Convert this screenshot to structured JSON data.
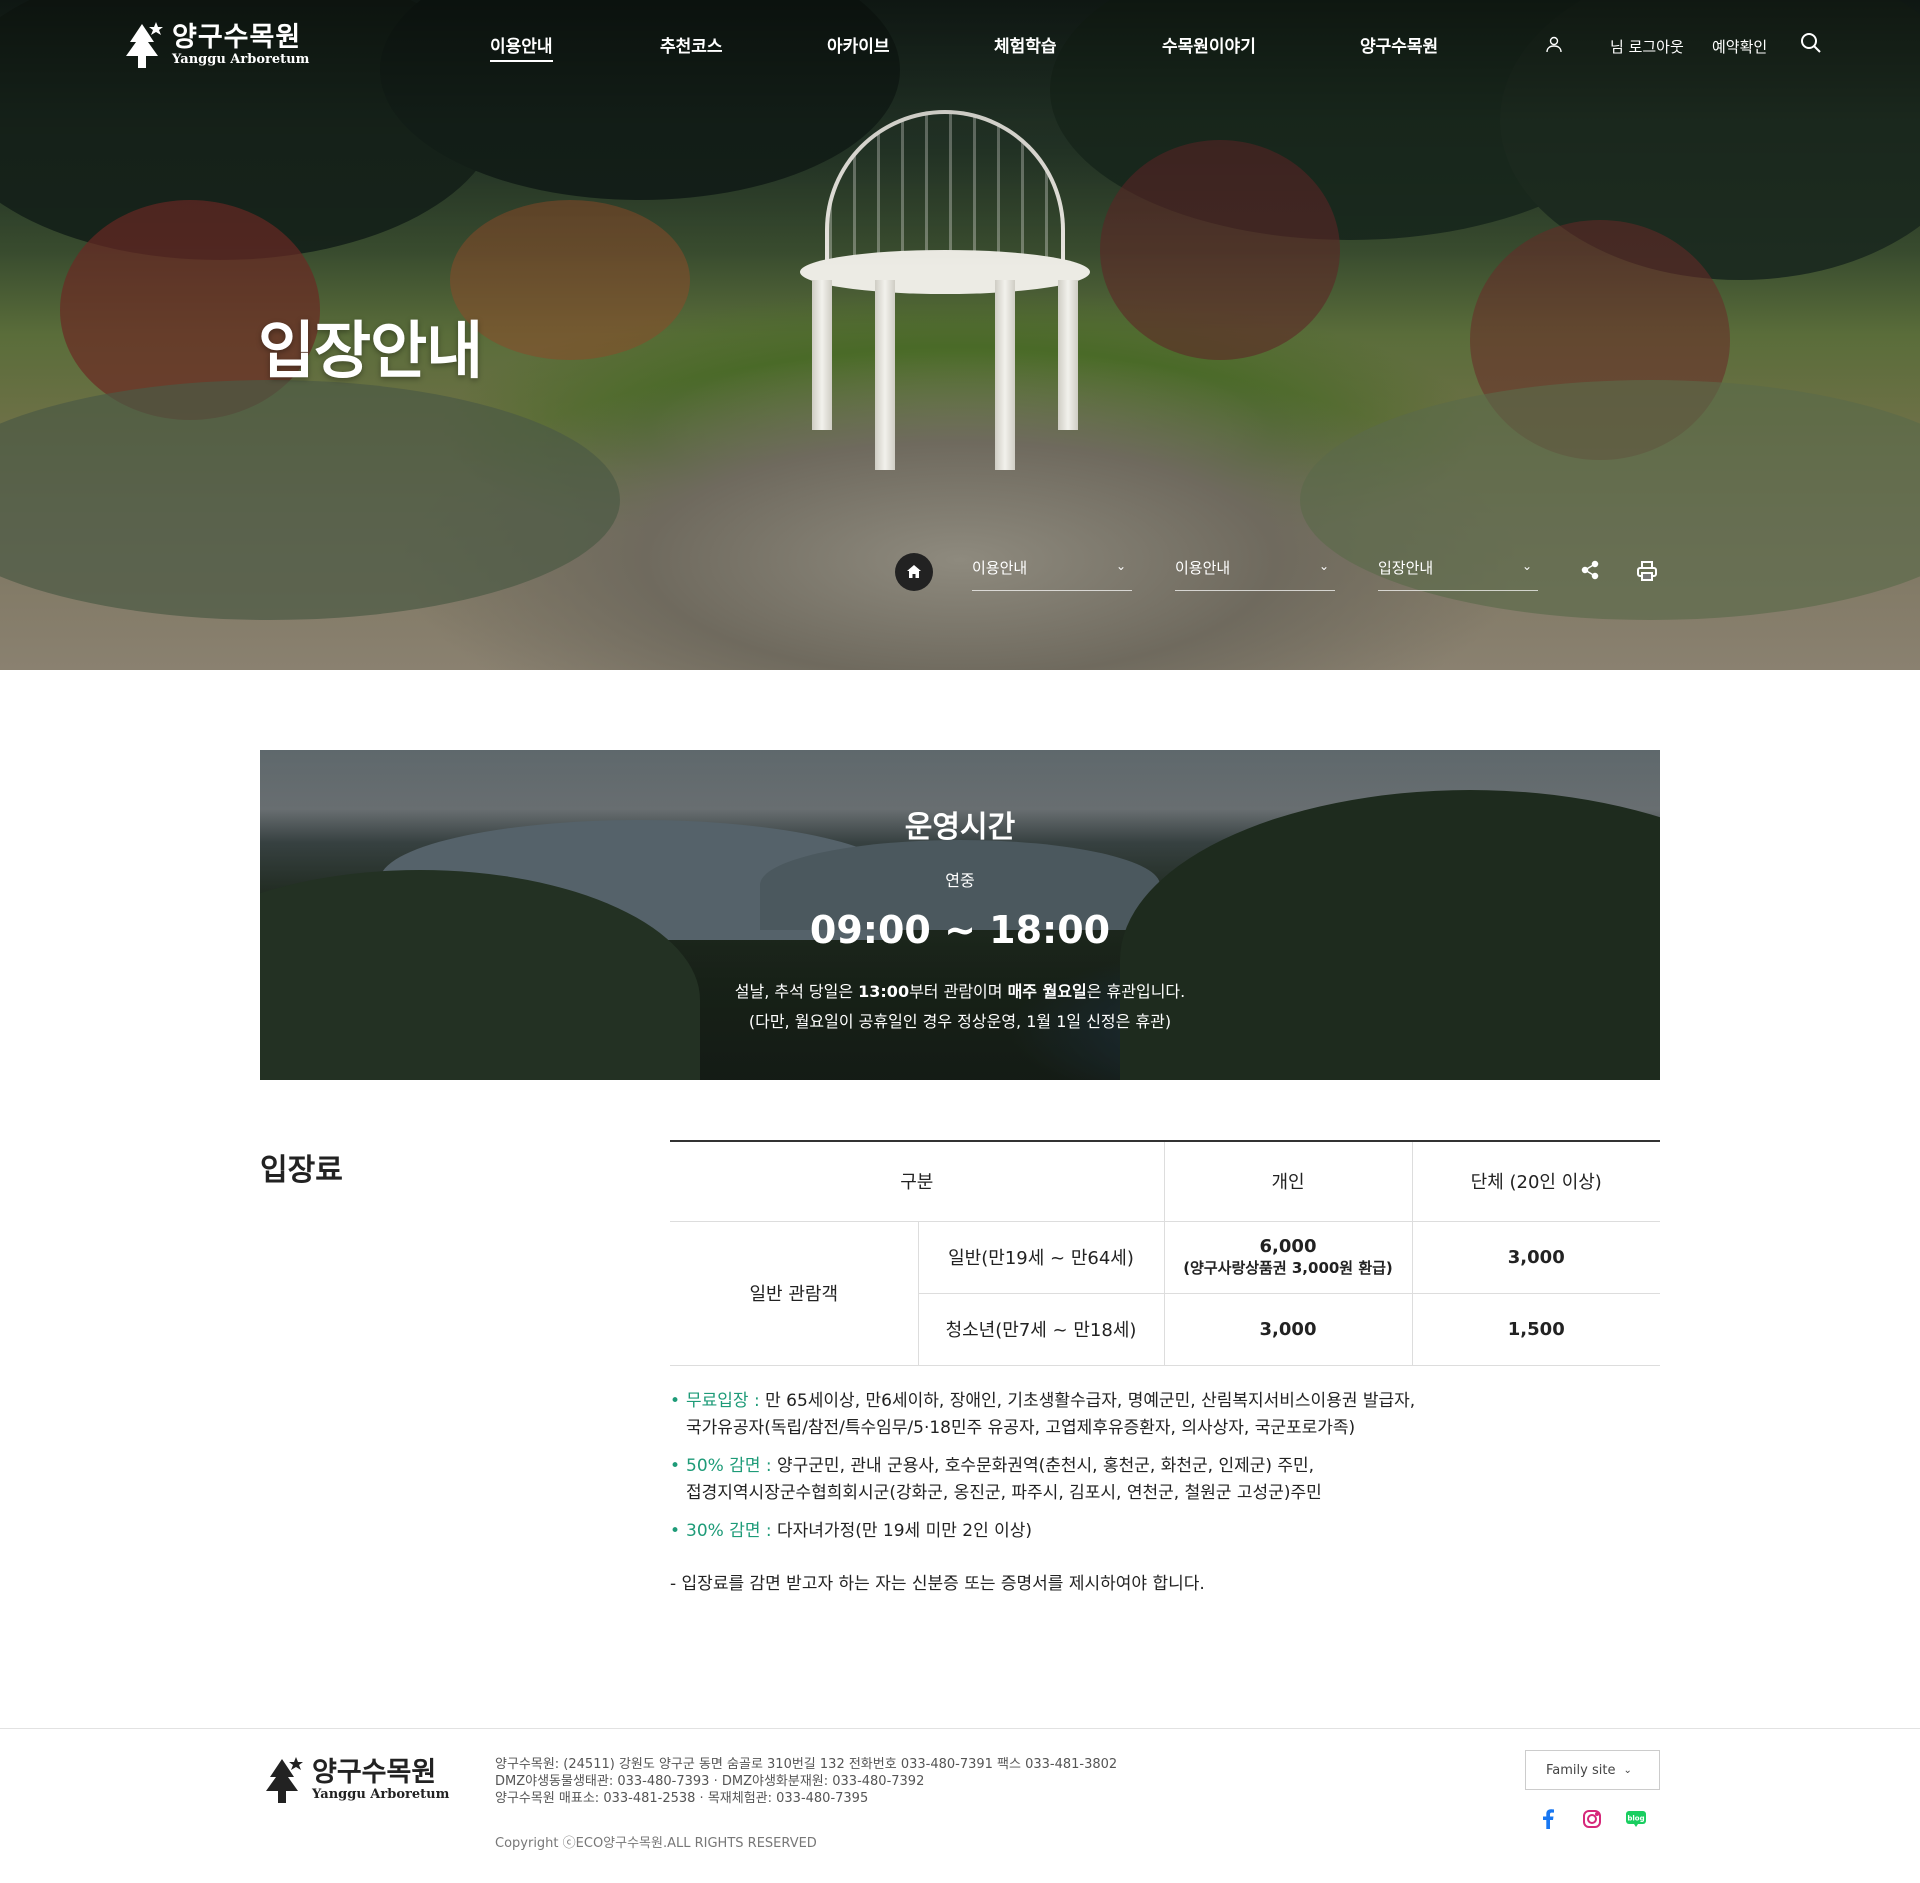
{
  "header": {
    "logo_title": "양구수목원",
    "logo_sub": "Yanggu Arboretum",
    "menu": [
      "이용안내",
      "추천코스",
      "아카이브",
      "체험학습",
      "수목원이야기",
      "양구수목원"
    ],
    "logout": "님 로그아웃",
    "reservation": "예약확인",
    "icons": [
      "user-icon",
      "search-icon"
    ]
  },
  "hero": {
    "title": "입장안내",
    "breadcrumb": [
      "이용안내",
      "이용안내",
      "입장안내"
    ],
    "icons": [
      "home-icon",
      "share-icon",
      "print-icon"
    ]
  },
  "hours": {
    "title": "운영시간",
    "season": "연중",
    "time": "09:00 ~ 18:00",
    "note_parts": [
      "설날, 추석 당일은 ",
      "13:00",
      "부터 관람이며 ",
      "매주 월요일",
      "은 휴관입니다."
    ],
    "note2": "(다만, 월요일이 공휴일인 경우 정상운영, 1월 1일 신정은 휴관)"
  },
  "fee": {
    "section_title": "입장료",
    "headers": [
      "구분",
      "개인",
      "단체 (20인 이상)"
    ],
    "category": "일반 관람객",
    "rows": [
      {
        "label": "일반(만19세 ~ 만64세)",
        "personal": "6,000",
        "personal_note": "(양구사랑상품권 3,000원 환급)",
        "group": "3,000"
      },
      {
        "label": "청소년(만7세 ~ 만18세)",
        "personal": "3,000",
        "group": "1,500"
      }
    ]
  },
  "notes": [
    {
      "label": "무료입장 :",
      "text": " 만 65세이상, 만6세이하, 장애인, 기초생활수급자, 명예군민, 산림복지서비스이용권 발급자,",
      "text2": "국가유공자(독립/참전/특수임무/5·18민주 유공자, 고엽제후유증환자, 의사상자, 국군포로가족)"
    },
    {
      "label": "50% 감면 :",
      "text": " 양구군민, 관내 군용사, 호수문화권역(춘천시, 홍천군, 화천군, 인제군) 주민,",
      "text2": "접경지역시장군수협희회시군(강화군, 옹진군, 파주시, 김포시, 연천군, 철원군 고성군)주민"
    },
    {
      "label": "30% 감면 :",
      "text": " 다자녀가정(만 19세 미만 2인 이상)",
      "text2": ""
    }
  ],
  "note_footer": "- 입장료를 감면 받고자 하는 자는 신분증 또는 증명서를 제시하여야 합니다.",
  "footer": {
    "logo_title": "양구수목원",
    "logo_sub": "Yanggu Arboretum",
    "info": [
      "양구수목원: (24511) 강원도 양구군 동면 숨골로 310번길 132 전화번호 033-480-7391 팩스 033-481-3802",
      "DMZ야생동물생태관: 033-480-7393 · DMZ야생화분재원: 033-480-7392",
      "양구수목원 매표소: 033-481-2538 · 목재체험관: 033-480-7395"
    ],
    "copyright": "Copyright ⓒECO양구수목원.ALL RIGHTS RESERVED",
    "family_site": "Family site",
    "sns": [
      "facebook-icon",
      "instagram-icon",
      "blog-icon"
    ],
    "blog_label": "blog"
  },
  "colors": {
    "accent": "#1e9b78",
    "text": "#222222"
  }
}
